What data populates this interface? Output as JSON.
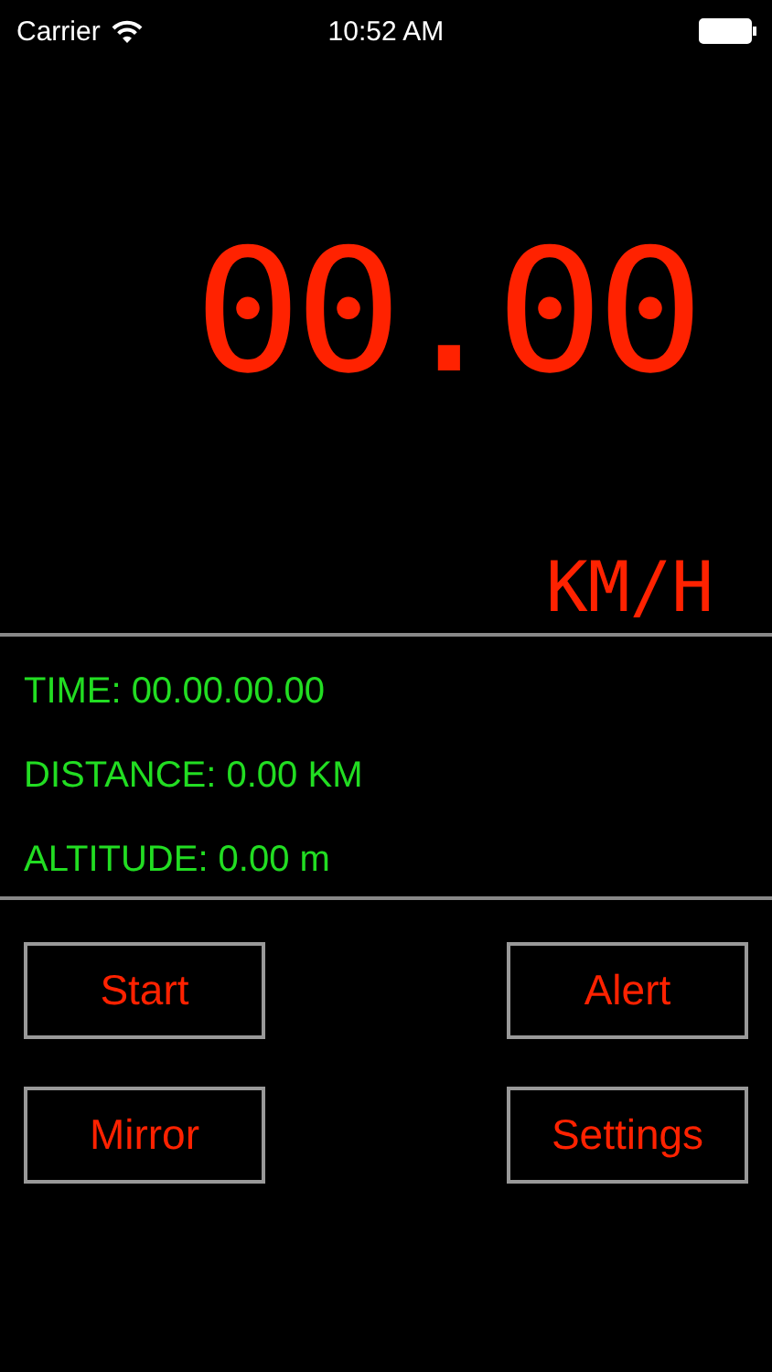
{
  "status_bar": {
    "carrier": "Carrier",
    "time": "10:52 AM"
  },
  "speedometer": {
    "speed": "00.00",
    "unit": "KM/H"
  },
  "readings": [
    {
      "text": "TIME: 00.00.00.00"
    },
    {
      "text": "DISTANCE: 0.00 KM"
    },
    {
      "text": "ALTITUDE: 0.00 m"
    }
  ],
  "buttons": [
    {
      "label": "Start"
    },
    {
      "label": "Alert"
    },
    {
      "label": "Mirror"
    },
    {
      "label": "Settings"
    }
  ]
}
